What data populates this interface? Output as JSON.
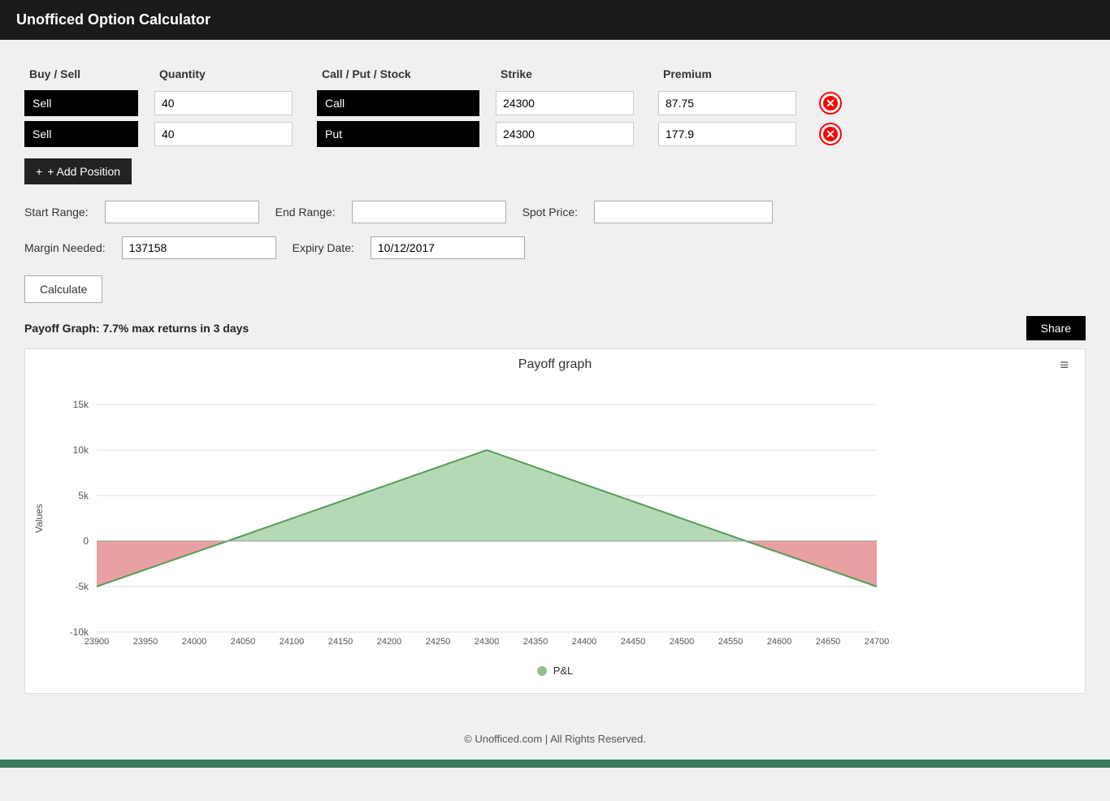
{
  "header": {
    "title": "Unofficed Option Calculator"
  },
  "columns": {
    "buy_sell": "Buy / Sell",
    "quantity": "Quantity",
    "call_put_stock": "Call / Put / Stock",
    "strike": "Strike",
    "premium": "Premium"
  },
  "positions": [
    {
      "buy_sell": "Sell",
      "quantity": "40",
      "call_put": "Call",
      "strike": "24300",
      "premium": "87.75"
    },
    {
      "buy_sell": "Sell",
      "quantity": "40",
      "call_put": "Put",
      "strike": "24300",
      "premium": "177.9"
    }
  ],
  "add_position_btn": "+ Add Position",
  "start_range_label": "Start Range:",
  "start_range_value": "",
  "end_range_label": "End Range:",
  "end_range_value": "",
  "spot_price_label": "Spot Price:",
  "spot_price_value": "",
  "margin_needed_label": "Margin Needed:",
  "margin_needed_value": "137158",
  "expiry_date_label": "Expiry Date:",
  "expiry_date_value": "10/12/2017",
  "calculate_btn": "Calculate",
  "payoff_label": "Payoff Graph: 7.7% max returns in 3 days",
  "share_btn": "Share",
  "chart": {
    "title": "Payoff graph",
    "menu_icon": "≡",
    "y_label": "Values",
    "legend": "P&L",
    "x_labels": [
      "23900",
      "23950",
      "24000",
      "24050",
      "24100",
      "24150",
      "24200",
      "24250",
      "24300",
      "24350",
      "24400",
      "24450",
      "24500",
      "24550",
      "24600",
      "24650",
      "24700"
    ],
    "y_labels": [
      "15k",
      "10k",
      "5k",
      "0",
      "-5k",
      "-10k"
    ],
    "positive_color": "#b5d9b5",
    "negative_color": "#e8a0a0"
  },
  "footer": {
    "text": "© Unofficed.com | All Rights Reserved."
  }
}
